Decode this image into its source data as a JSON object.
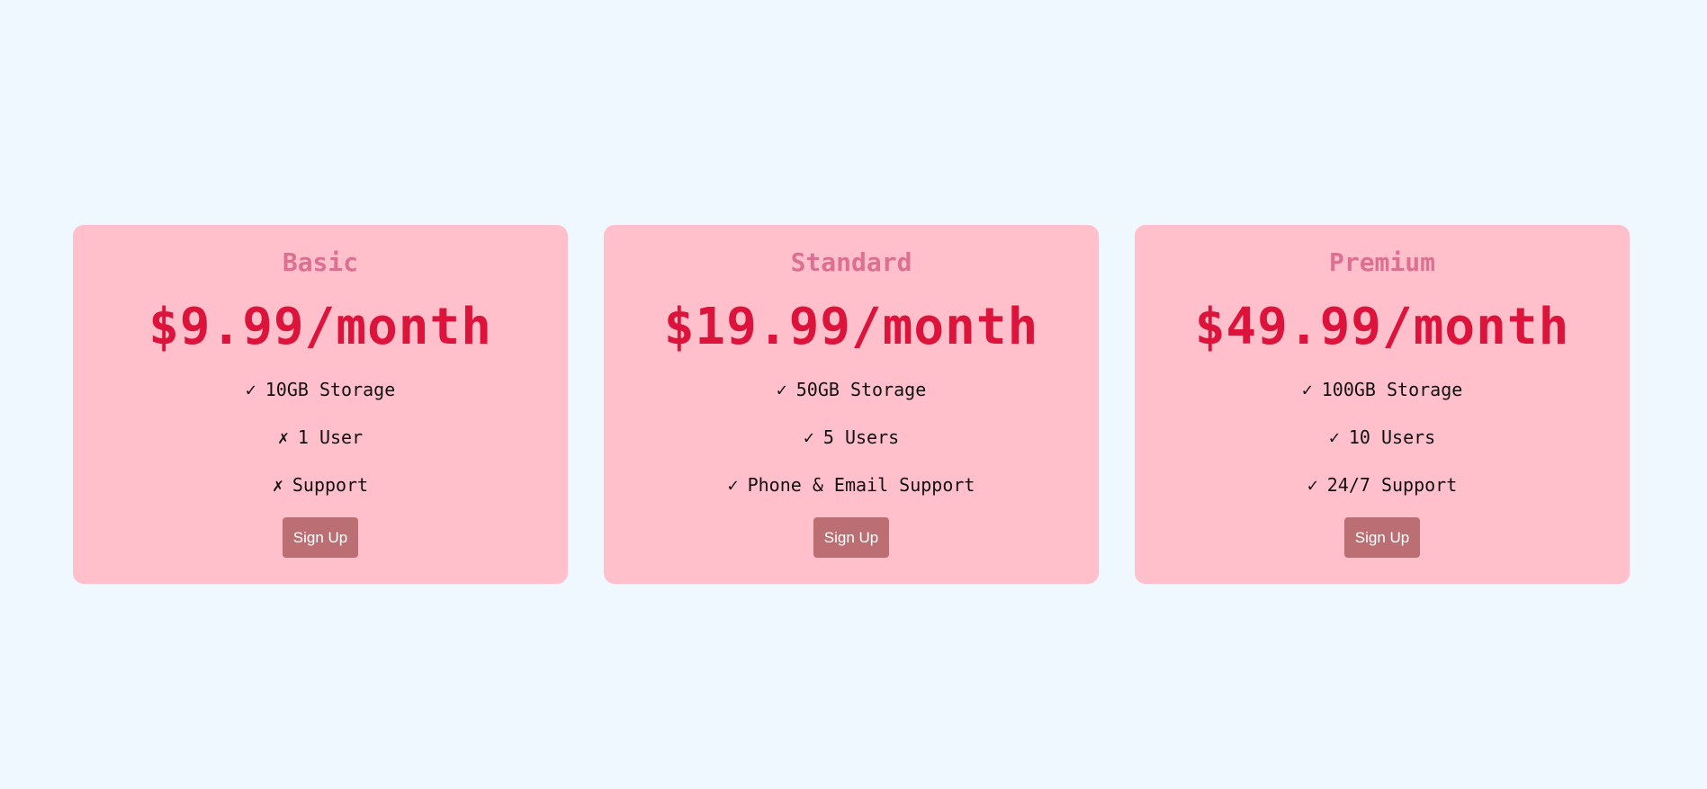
{
  "plans": [
    {
      "name": "Basic",
      "price": "$9.99/month",
      "features": [
        {
          "mark": "✓",
          "icon": "check-icon",
          "text": "10GB Storage"
        },
        {
          "mark": "✗",
          "icon": "cross-icon",
          "text": "1 User"
        },
        {
          "mark": "✗",
          "icon": "cross-icon",
          "text": "Support"
        }
      ],
      "button": "Sign Up"
    },
    {
      "name": "Standard",
      "price": "$19.99/month",
      "features": [
        {
          "mark": "✓",
          "icon": "check-icon",
          "text": "50GB Storage"
        },
        {
          "mark": "✓",
          "icon": "check-icon",
          "text": "5 Users"
        },
        {
          "mark": "✓",
          "icon": "check-icon",
          "text": "Phone & Email Support"
        }
      ],
      "button": "Sign Up"
    },
    {
      "name": "Premium",
      "price": "$49.99/month",
      "features": [
        {
          "mark": "✓",
          "icon": "check-icon",
          "text": "100GB Storage"
        },
        {
          "mark": "✓",
          "icon": "check-icon",
          "text": "10 Users"
        },
        {
          "mark": "✓",
          "icon": "check-icon",
          "text": "24/7 Support"
        }
      ],
      "button": "Sign Up"
    }
  ],
  "colors": {
    "page_background": "#f0f8ff",
    "card_background": "#ffc0cb",
    "plan_name": "#db7093",
    "price": "#dc143c",
    "button_background": "#bc6f72",
    "button_text": "#ffffff"
  }
}
